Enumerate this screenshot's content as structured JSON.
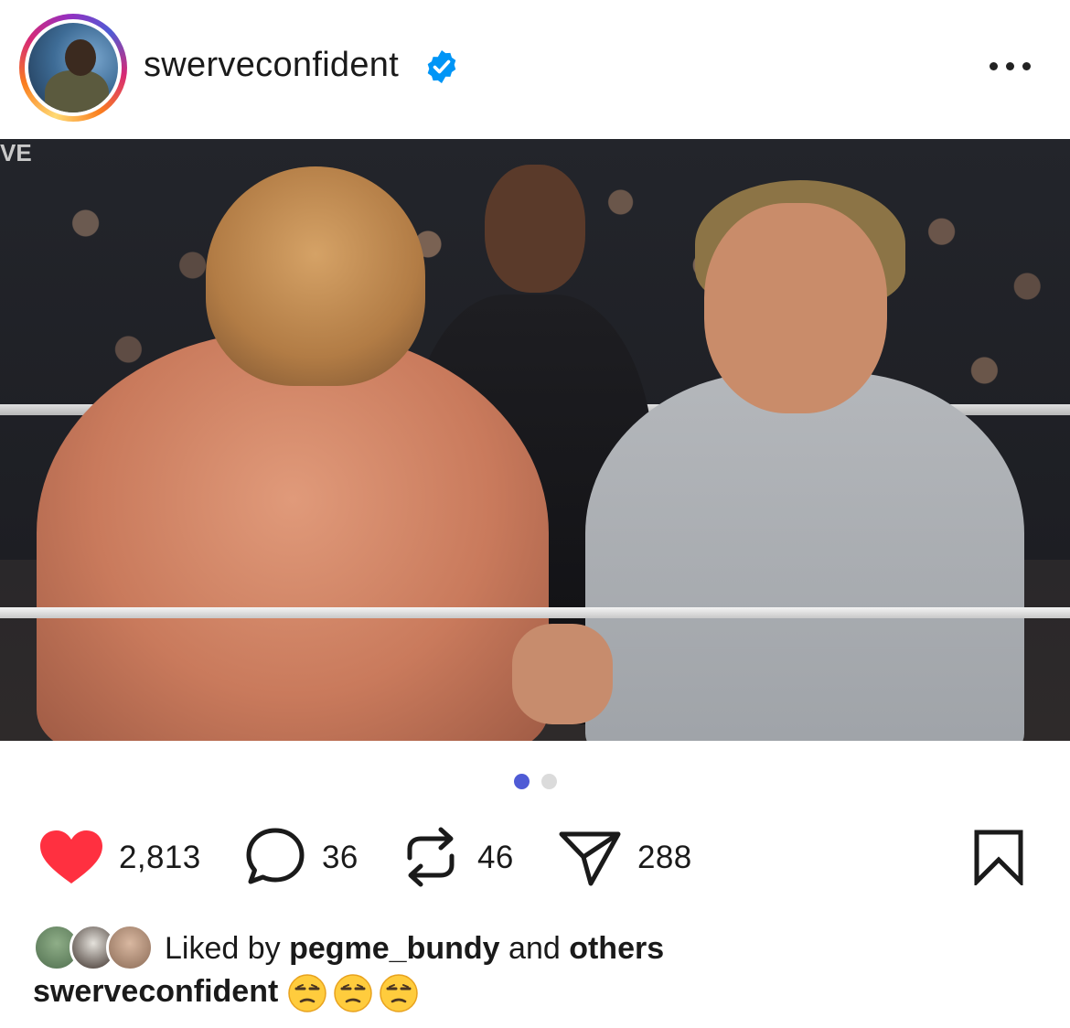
{
  "post": {
    "username": "swerveconfident",
    "verified": true,
    "more_icon": "more-horizontal-icon",
    "carousel": {
      "total": 2,
      "current": 1,
      "active_color": "#4F5BD5",
      "inactive_color": "#DBDBDB"
    },
    "photo_overlay_text": "VE",
    "tag_icon": "user-tag-icon"
  },
  "actions": {
    "like": {
      "icon": "heart-filled-icon",
      "count": "2,813",
      "color": "#FF3040"
    },
    "comment": {
      "icon": "comment-bubble-icon",
      "count": "36"
    },
    "repost": {
      "icon": "repost-icon",
      "count": "46"
    },
    "share": {
      "icon": "paper-plane-icon",
      "count": "288"
    },
    "save": {
      "icon": "bookmark-icon"
    }
  },
  "likes": {
    "prefix": "Liked by",
    "user": "pegme_bundy",
    "conjunction": "and",
    "others": "others"
  },
  "caption": {
    "username": "swerveconfident",
    "emojis": "😒😒😒"
  }
}
